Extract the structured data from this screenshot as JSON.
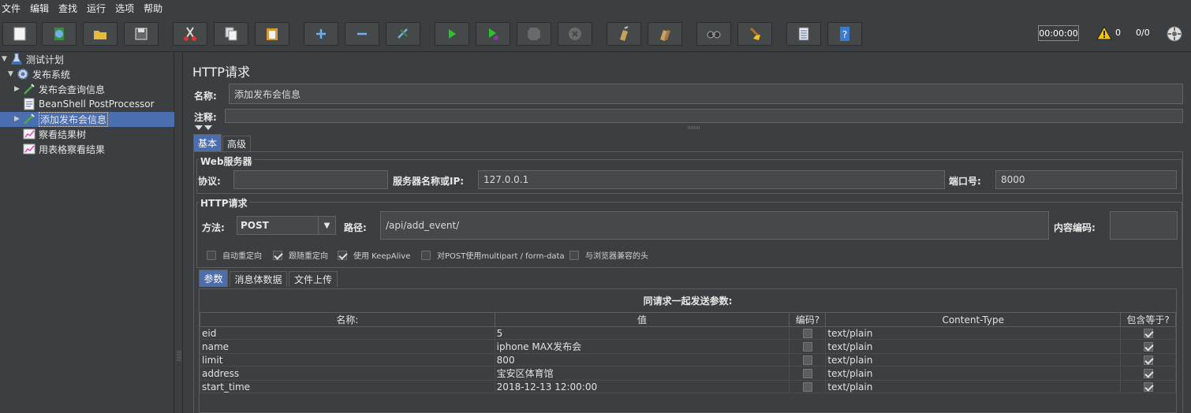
{
  "menu": [
    "文件",
    "编辑",
    "查找",
    "运行",
    "选项",
    "帮助"
  ],
  "toolbar": {
    "buttons": [
      "new-icon",
      "templates-icon",
      "open-icon",
      "save-icon",
      "cut-icon",
      "copy-icon",
      "paste-icon",
      "expand-icon",
      "collapse-icon",
      "toggle-icon",
      "start-icon",
      "start-no-pause-icon",
      "stop-icon",
      "shutdown-icon",
      "clear-icon",
      "clear-all-icon",
      "search-icon",
      "reset-search-icon",
      "function-helper-icon",
      "help-icon"
    ],
    "timer": "00:00:00",
    "warning_count": "0",
    "thread_ratio": "0/0"
  },
  "tree": {
    "items": [
      {
        "label": "测试计划",
        "icon": "test-plan-icon",
        "arrow": "▼"
      },
      {
        "label": "发布系统",
        "icon": "thread-group-gear-icon",
        "arrow": "▼"
      },
      {
        "label": "发布会查询信息",
        "icon": "sampler-pipette-icon",
        "arrow": "▶"
      },
      {
        "label": "BeanShell PostProcessor",
        "icon": "document-icon",
        "arrow": ""
      },
      {
        "label": "添加发布会信息",
        "icon": "sampler-pipette-icon",
        "arrow": "▶"
      },
      {
        "label": "察看结果树",
        "icon": "listener-chart-icon",
        "arrow": ""
      },
      {
        "label": "用表格察看结果",
        "icon": "listener-chart-icon",
        "arrow": ""
      }
    ]
  },
  "panel": {
    "title": "HTTP请求",
    "name_label": "名称:",
    "name_value": "添加发布会信息",
    "comment_label": "注释:",
    "comment_value": "",
    "tabs": [
      "基本",
      "高级"
    ],
    "web_server": {
      "title": "Web服务器",
      "protocol_label": "协议:",
      "protocol_value": "",
      "server_label": "服务器名称或IP:",
      "server_value": "127.0.0.1",
      "port_label": "端口号:",
      "port_value": "8000"
    },
    "http_request": {
      "title": "HTTP请求",
      "method_label": "方法:",
      "method_value": "POST",
      "path_label": "路径:",
      "path_value": "/api/add_event/",
      "encoding_label": "内容编码:",
      "encoding_value": "",
      "options": [
        {
          "label": "自动重定向",
          "checked": false
        },
        {
          "label": "跟随重定向",
          "checked": true
        },
        {
          "label": "使用 KeepAlive",
          "checked": true
        },
        {
          "label": "对POST使用multipart / form-data",
          "checked": false
        },
        {
          "label": "与浏览器兼容的头",
          "checked": false
        }
      ]
    },
    "sub_tabs": [
      "参数",
      "消息体数据",
      "文件上传"
    ],
    "params_title": "同请求一起发送参数:",
    "columns": [
      "名称:",
      "值",
      "编码?",
      "Content-Type",
      "包含等于?"
    ],
    "rows": [
      {
        "name": "eid",
        "value": "5",
        "encode": false,
        "content_type": "text/plain",
        "include_equals": true
      },
      {
        "name": "name",
        "value": "iphone MAX发布会",
        "encode": false,
        "content_type": "text/plain",
        "include_equals": true
      },
      {
        "name": "limit",
        "value": "800",
        "encode": false,
        "content_type": "text/plain",
        "include_equals": true
      },
      {
        "name": "address",
        "value": "宝安区体育馆",
        "encode": false,
        "content_type": "text/plain",
        "include_equals": true
      },
      {
        "name": "start_time",
        "value": "2018-12-13 12:00:00",
        "encode": false,
        "content_type": "text/plain",
        "include_equals": true
      }
    ]
  }
}
